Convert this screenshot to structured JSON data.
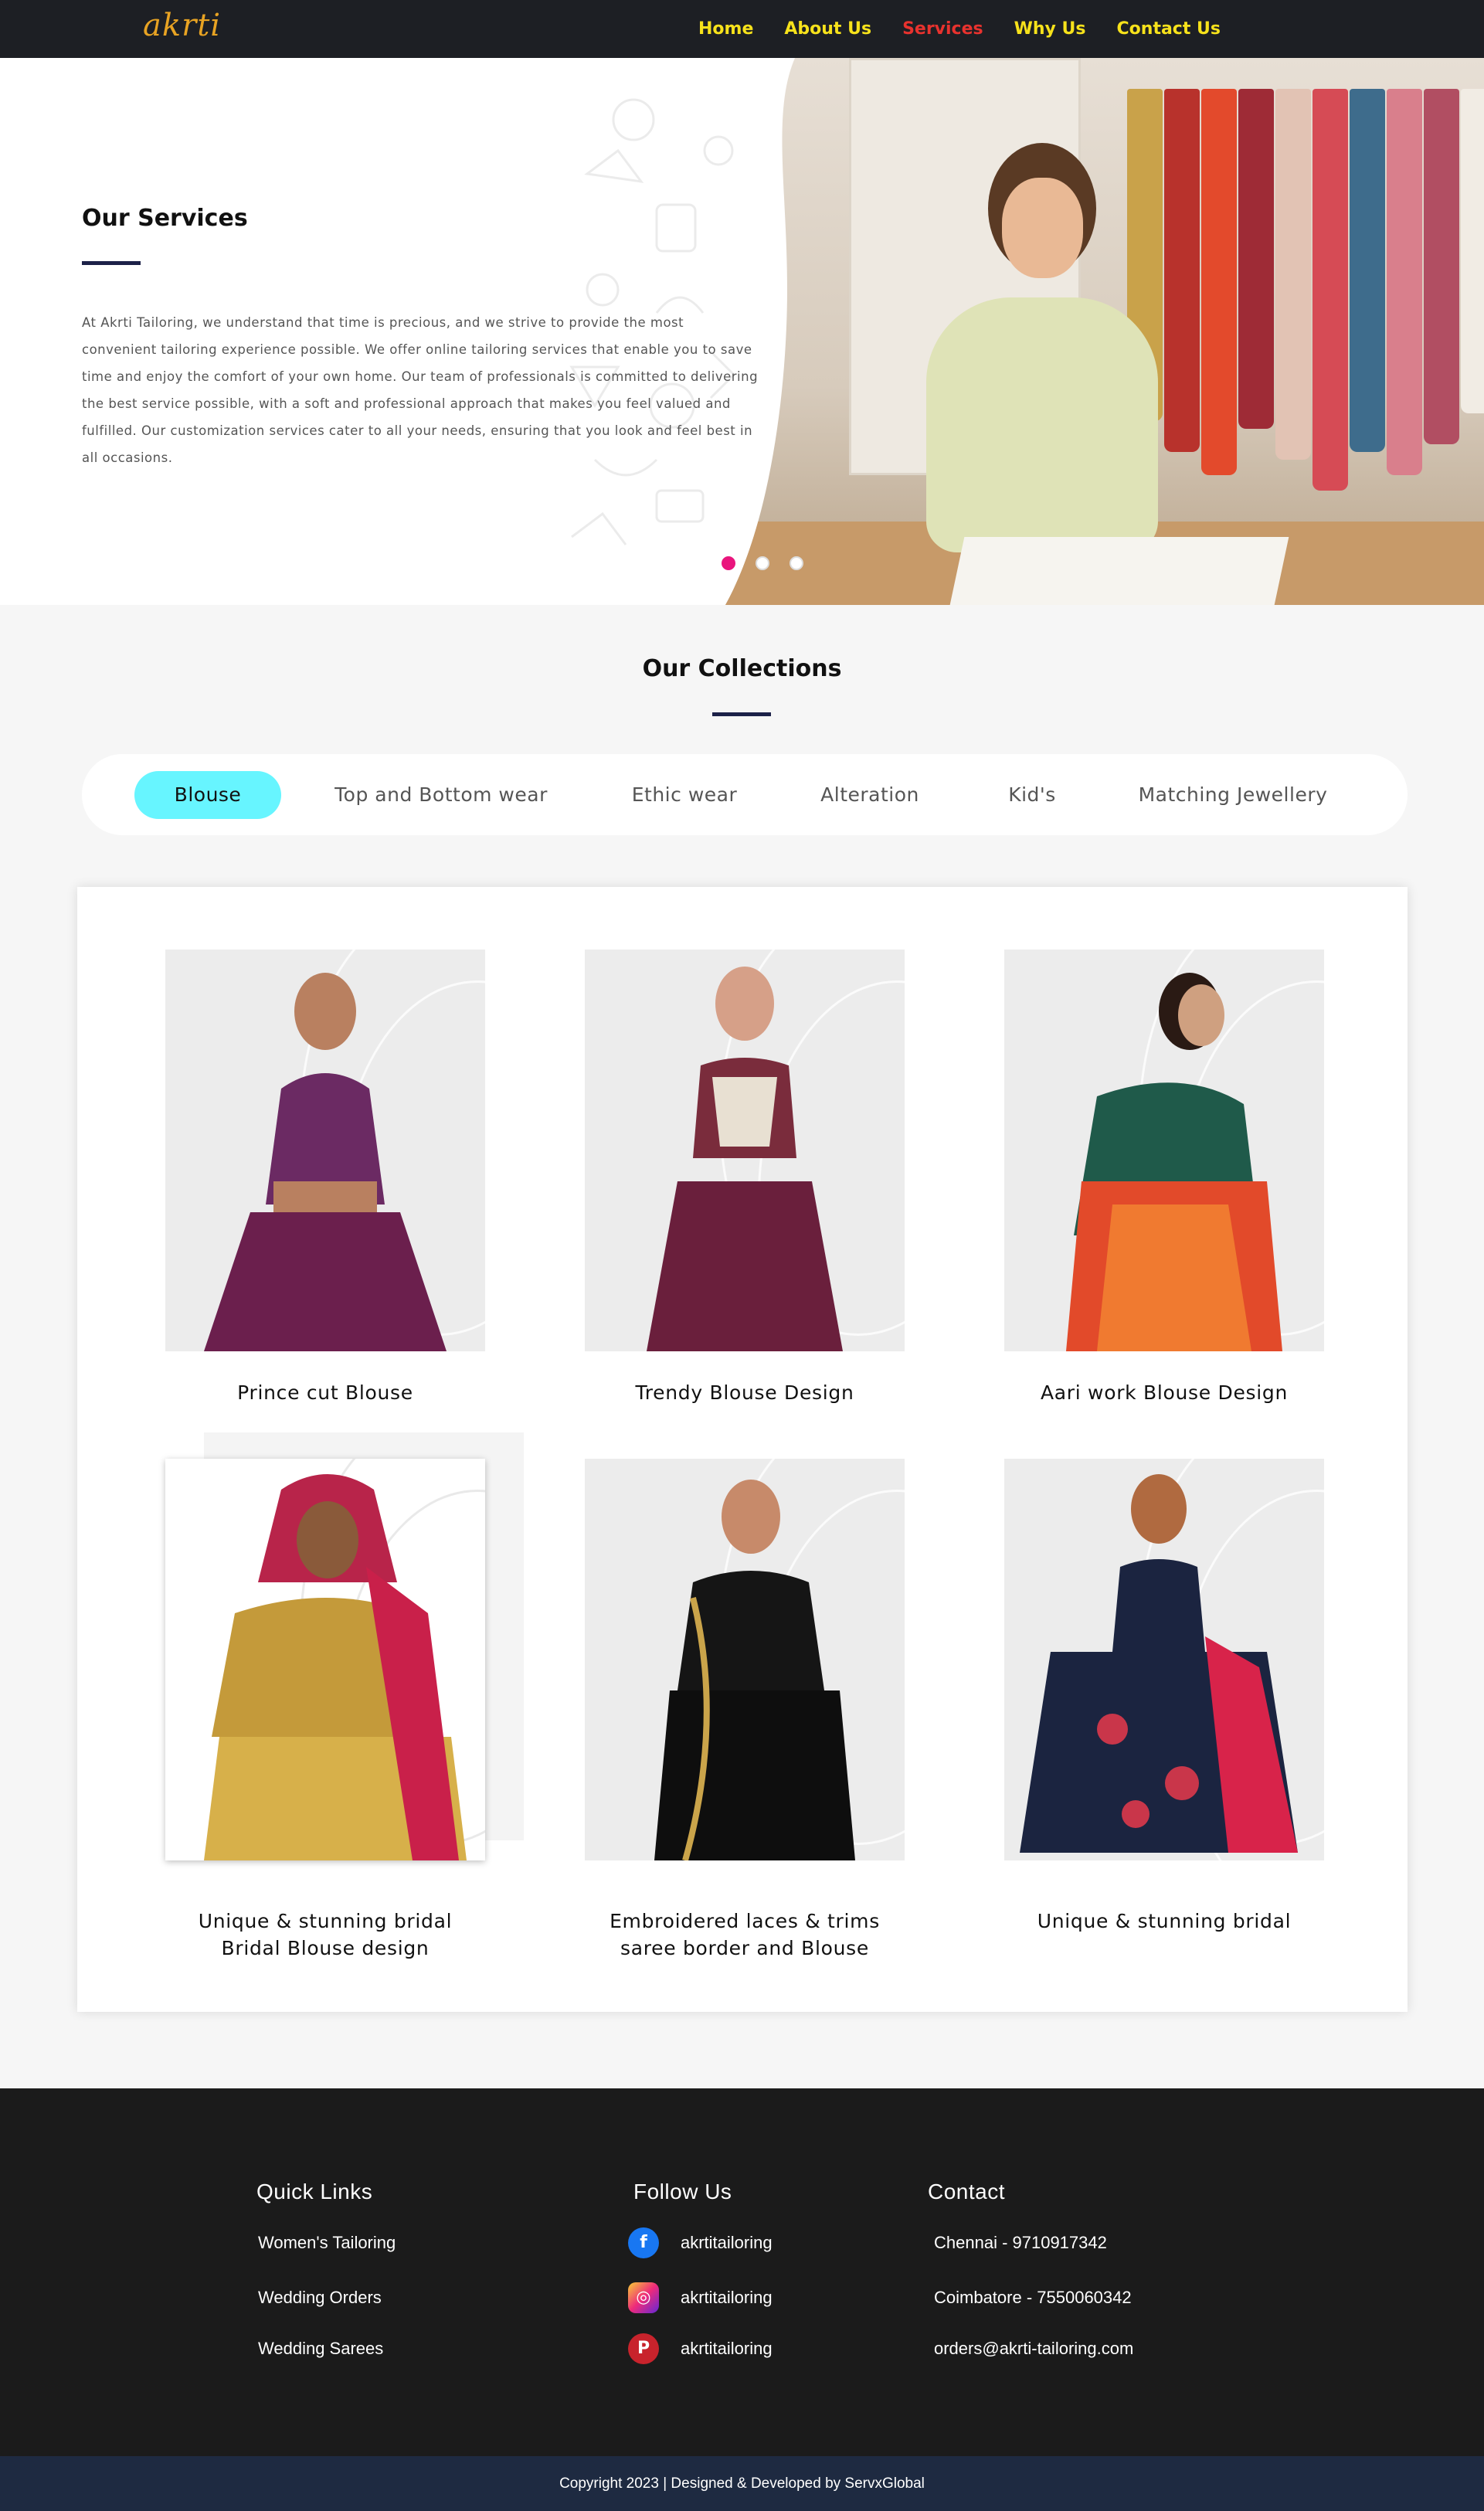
{
  "brand": {
    "logo_text": "akrti",
    "logo_color": "#e8a323"
  },
  "nav": {
    "items": [
      {
        "label": "Home",
        "active": false
      },
      {
        "label": "About Us",
        "active": false
      },
      {
        "label": "Services",
        "active": true
      },
      {
        "label": "Why Us",
        "active": false
      },
      {
        "label": "Contact Us",
        "active": false
      }
    ],
    "link_color": "#f7e21b",
    "active_color": "#e8322e"
  },
  "hero": {
    "title": "Our Services",
    "text": "At Akrti Tailoring, we understand that time is precious, and we strive to provide the most convenient tailoring experience possible. We offer online tailoring services that enable you to save time and enjoy the comfort of your own home. Our team of professionals is committed to delivering the best service possible, with a soft and professional approach that makes you feel valued and fulfilled. Our customization services cater to all your needs, ensuring that you look and feel best in all occasions.",
    "slides_total": 3,
    "slide_active": 1,
    "dot_active_color": "#e9157d"
  },
  "collections": {
    "title": "Our Collections",
    "tabs": [
      {
        "label": "Blouse",
        "active": true
      },
      {
        "label": "Top and Bottom wear",
        "active": false
      },
      {
        "label": "Ethic wear",
        "active": false
      },
      {
        "label": "Alteration",
        "active": false
      },
      {
        "label": "Kid's",
        "active": false
      },
      {
        "label": "Matching Jewellery",
        "active": false
      }
    ],
    "active_tab_color": "#67f5ff",
    "items": [
      {
        "label": "Prince cut Blouse"
      },
      {
        "label": "Trendy Blouse Design"
      },
      {
        "label": "Aari work Blouse Design"
      },
      {
        "label_line1": "Unique & stunning bridal",
        "label_line2": "Bridal Blouse design"
      },
      {
        "label_line1": "Embroidered laces & trims",
        "label_line2": "saree border and Blouse"
      },
      {
        "label": "Unique & stunning bridal"
      }
    ]
  },
  "footer": {
    "quick_links": {
      "title": "Quick Links",
      "items": [
        "Women's Tailoring",
        "Wedding Orders",
        "Wedding Sarees"
      ]
    },
    "follow_us": {
      "title": "Follow Us",
      "items": [
        {
          "icon": "facebook-icon",
          "glyph": "f",
          "handle": "akrtitailoring"
        },
        {
          "icon": "instagram-icon",
          "glyph": "◎",
          "handle": "akrtitailoring"
        },
        {
          "icon": "pinterest-icon",
          "glyph": "P",
          "handle": "akrtitailoring"
        }
      ]
    },
    "contact": {
      "title": "Contact",
      "items": [
        "Chennai - 9710917342",
        "Coimbatore - 7550060342",
        "orders@akrti-tailoring.com"
      ]
    },
    "copyright": "Copyright 2023 | Designed & Developed by ServxGlobal"
  }
}
